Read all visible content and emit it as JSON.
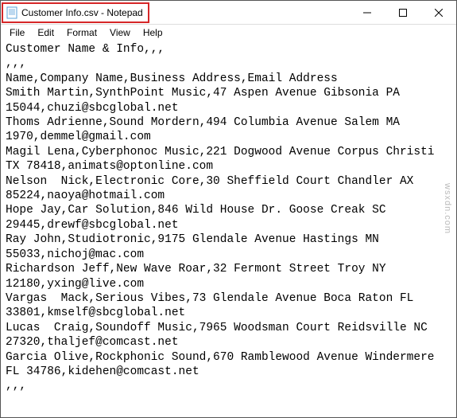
{
  "window": {
    "title": "Customer Info.csv - Notepad"
  },
  "menu": {
    "file": "File",
    "edit": "Edit",
    "format": "Format",
    "view": "View",
    "help": "Help"
  },
  "content": {
    "lines": [
      "Customer Name & Info,,,",
      ",,,",
      "Name,Company Name,Business Address,Email Address",
      "Smith Martin,SynthPoint Music,47 Aspen Avenue Gibsonia PA 15044,chuzi@sbcglobal.net",
      "Thoms Adrienne,Sound Mordern,494 Columbia Avenue Salem MA 1970,demmel@gmail.com",
      "Magil Lena,Cyberphonoc Music,221 Dogwood Avenue Corpus Christi TX 78418,animats@optonline.com",
      "Nelson  Nick,Electronic Core,30 Sheffield Court Chandler AX 85224,naoya@hotmail.com",
      "Hope Jay,Car Solution,846 Wild House Dr. Goose Creak SC 29445,drewf@sbcglobal.net",
      "Ray John,Studiotronic,9175 Glendale Avenue Hastings MN 55033,nichoj@mac.com",
      "Richardson Jeff,New Wave Roar,32 Fermont Street Troy NY 12180,yxing@live.com",
      "Vargas  Mack,Serious Vibes,73 Glendale Avenue Boca Raton FL 33801,kmself@sbcglobal.net",
      "Lucas  Craig,Soundoff Music,7965 Woodsman Court Reidsville NC 27320,thaljef@comcast.net",
      "Garcia Olive,Rockphonic Sound,670 Ramblewood Avenue Windermere FL 34786,kidehen@comcast.net",
      ",,,"
    ]
  },
  "watermark": "wsxdn.com"
}
